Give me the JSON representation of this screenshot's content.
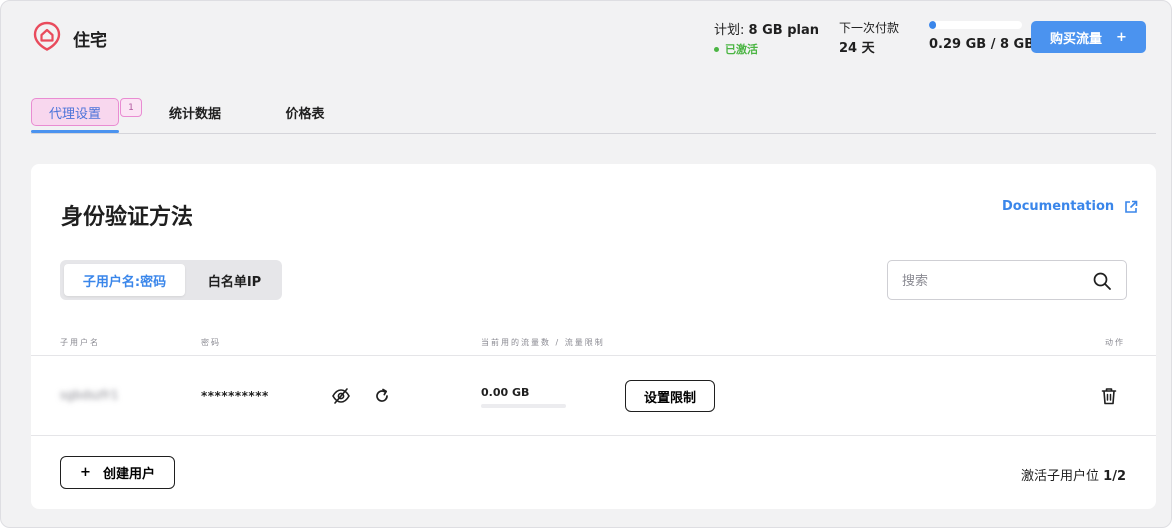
{
  "header": {
    "brand": "住宅",
    "plan_label": "计划: ",
    "plan_value": "8 GB plan",
    "status": "已激活",
    "next_payment_label": "下一次付款",
    "next_payment_value": "24 天",
    "usage_text": "0.29 GB / 8 GB",
    "usage_fraction": 0.036,
    "buy_button": "购买流量",
    "buy_button_icon": "+"
  },
  "tabs": [
    {
      "label": "代理设置",
      "active": true,
      "badge": "1"
    },
    {
      "label": "统计数据"
    },
    {
      "label": "价格表"
    }
  ],
  "card": {
    "title": "身份验证方法",
    "documentation_link": "Documentation",
    "auth_modes": [
      "子用户名:密码",
      "白名单IP"
    ],
    "active_mode": "子用户名:密码",
    "search_placeholder": "搜索",
    "columns": {
      "username": "子用户名",
      "password": "密码",
      "traffic": "当前用的流量数 / 流量限制",
      "actions": "动作"
    },
    "rows": [
      {
        "username": "sgbdszfr1",
        "password": "**********",
        "traffic_used": "0.00 GB",
        "traffic_fraction": 0,
        "limit_button": "设置限制"
      }
    ],
    "create_user_button": "创建用户",
    "create_user_icon": "+",
    "slots_label": "激活子用户位 ",
    "slots_value": "1/2"
  },
  "colors": {
    "accent": "#4b93ef",
    "status_green": "#4bb543",
    "logo_red": "#e94b5c",
    "tab_highlight": "#f8d7ee"
  },
  "icons": [
    "home-logo-icon",
    "plus-icon",
    "external-link-icon",
    "search-icon",
    "eye-off-icon",
    "refresh-icon",
    "trash-icon"
  ]
}
